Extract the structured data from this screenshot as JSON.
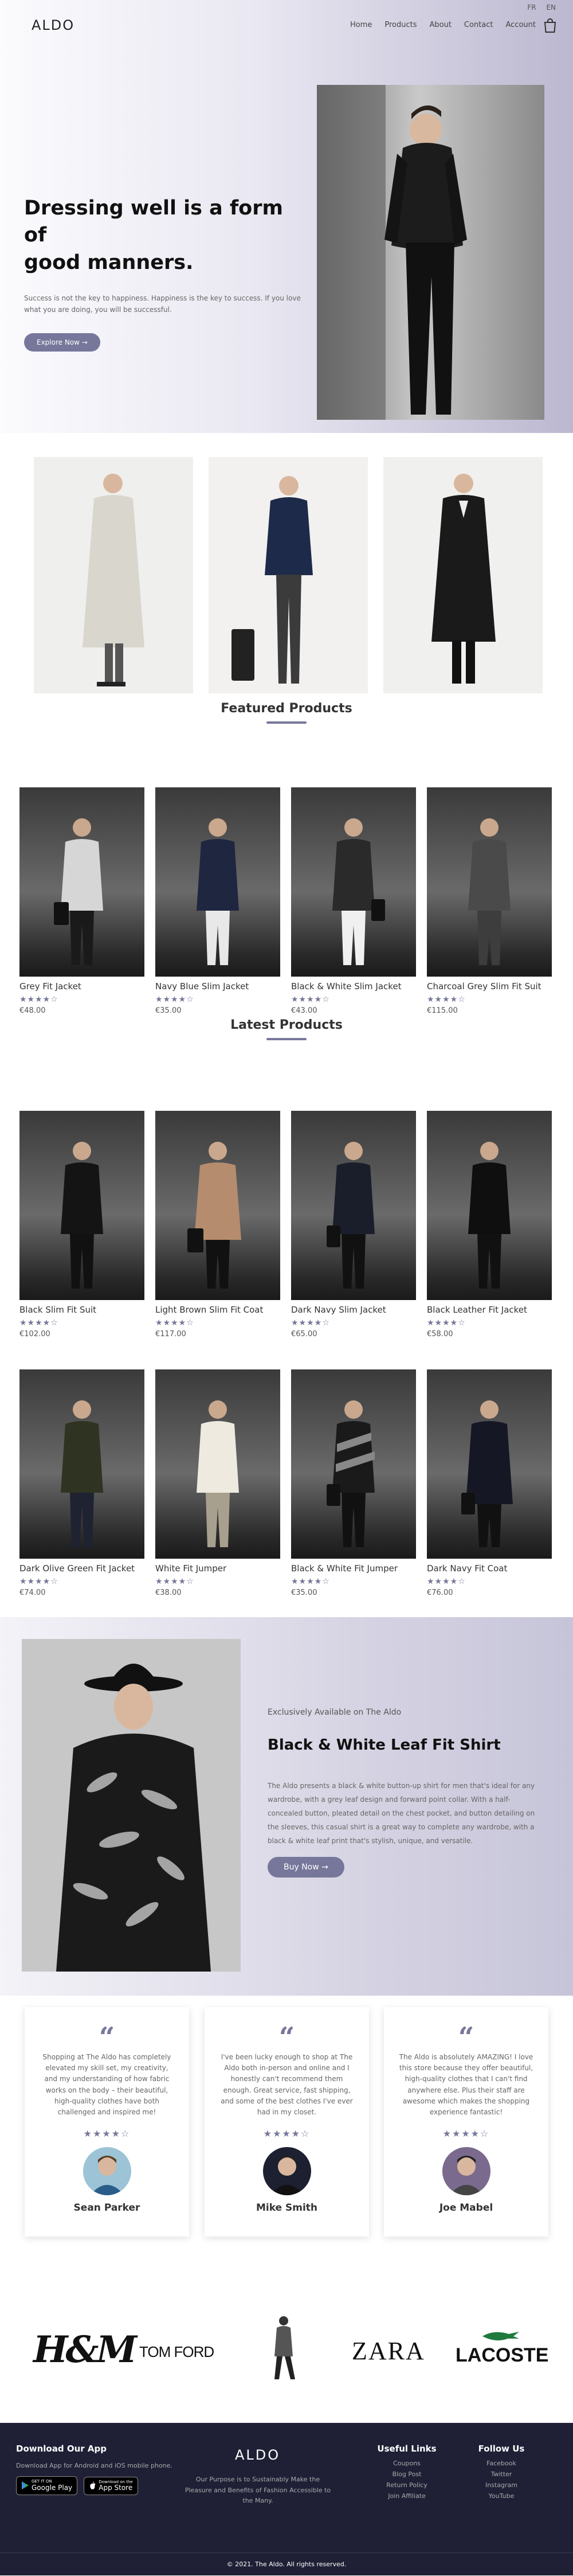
{
  "header": {
    "lang": [
      "FR",
      "EN"
    ],
    "logo": "ALDO",
    "nav": [
      "Home",
      "Products",
      "About",
      "Contact",
      "Account"
    ]
  },
  "hero": {
    "title_line1": "Dressing well is a form of",
    "title_line2": "good manners.",
    "subtitle": "Success is not the key to happiness. Happiness is the key to success. If you love what you are doing, you will be successful.",
    "button": "Explore Now →"
  },
  "featured": {
    "heading": "Featured Products",
    "products": [
      {
        "name": "Grey Fit Jacket",
        "stars": "★★★★☆",
        "price": "€48.00"
      },
      {
        "name": "Navy Blue Slim Jacket",
        "stars": "★★★★☆",
        "price": "€35.00"
      },
      {
        "name": "Black & White Slim Jacket",
        "stars": "★★★★☆",
        "price": "€43.00"
      },
      {
        "name": "Charcoal Grey Slim Fit Suit",
        "stars": "★★★★☆",
        "price": "€115.00"
      }
    ]
  },
  "latest": {
    "heading": "Latest Products",
    "products": [
      {
        "name": "Black Slim Fit Suit",
        "stars": "★★★★☆",
        "price": "€102.00"
      },
      {
        "name": "Light Brown Slim Fit Coat",
        "stars": "★★★★☆",
        "price": "€117.00"
      },
      {
        "name": "Dark Navy Slim Jacket",
        "stars": "★★★★☆",
        "price": "€65.00"
      },
      {
        "name": "Black Leather Fit Jacket",
        "stars": "★★★★☆",
        "price": "€58.00"
      },
      {
        "name": "Dark Olive Green Fit Jacket",
        "stars": "★★★★☆",
        "price": "€74.00"
      },
      {
        "name": "White Fit Jumper",
        "stars": "★★★★☆",
        "price": "€38.00"
      },
      {
        "name": "Black & White Fit Jumper",
        "stars": "★★★★☆",
        "price": "€35.00"
      },
      {
        "name": "Dark Navy Fit Coat",
        "stars": "★★★★☆",
        "price": "€76.00"
      }
    ]
  },
  "exclusive": {
    "pre": "Exclusively Available on The Aldo",
    "title": "Black & White Leaf Fit Shirt",
    "desc": "The Aldo presents a black & white button-up shirt for men that's ideal for any wardrobe, with a grey leaf design and forward point collar. With a half-concealed button, pleated detail on the chest pocket, and button detailing on the sleeves, this casual shirt is a great way to complete any wardrobe, with a black & white leaf print that's stylish, unique, and versatile.",
    "button": "Buy Now →"
  },
  "testimonials": [
    {
      "text": "Shopping at The Aldo has completely elevated my skill set, my creativity, and my understanding of how fabric works on the body – their beautiful, high-quality clothes have both challenged and inspired me!",
      "stars": "★★★★☆",
      "name": "Sean Parker"
    },
    {
      "text": "I've been lucky enough to shop at The Aldo both in-person and online and I honestly can't recommend them enough. Great service, fast shipping, and some of the best clothes I've ever had in my closet.",
      "stars": "★★★★☆",
      "name": "Mike Smith"
    },
    {
      "text": "The Aldo is absolutely AMAZING! I love this store because they offer beautiful, high-quality clothes that I can't find anywhere else. Plus their staff are awesome which makes the shopping experience fantastic!",
      "stars": "★★★★☆",
      "name": "Joe Mabel"
    }
  ],
  "brands": [
    "H&M",
    "TOM FORD",
    "ZARA",
    "LACOSTE"
  ],
  "footer": {
    "download_head": "Download Our App",
    "download_sub": "Download App for Android and iOS mobile phone.",
    "google_small": "GET IT ON",
    "google": "Google Play",
    "apple_small": "Download on the",
    "apple": "App Store",
    "logo": "ALDO",
    "about": "Our Purpose is to Sustainably Make the Pleasure and Benefits of Fashion Accessible to the Many.",
    "links_head": "Useful Links",
    "links": [
      "Coupons",
      "Blog Post",
      "Return Policy",
      "Join Affiliate"
    ],
    "follow_head": "Follow Us",
    "follow": [
      "Facebook",
      "Twitter",
      "Instagram",
      "YouTube"
    ],
    "copyright": "© 2021. The Aldo. All rights reserved."
  },
  "colors": {
    "accent": "#76779a",
    "footer_bg": "#1f2036"
  }
}
